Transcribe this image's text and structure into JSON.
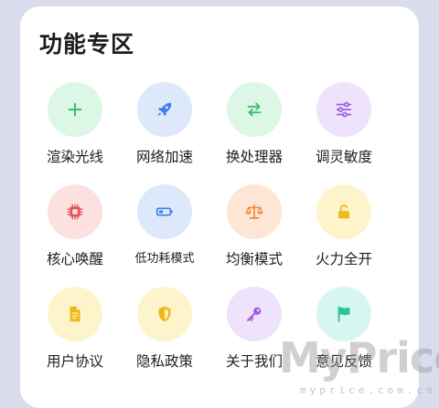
{
  "section": {
    "title": "功能专区"
  },
  "tiles": [
    {
      "label": "渲染光线",
      "icon": "plus-icon",
      "bg": "#dcf7e6",
      "fg": "#3bbf6a"
    },
    {
      "label": "网络加速",
      "icon": "rocket-icon",
      "bg": "#dde9fb",
      "fg": "#3f7ee8"
    },
    {
      "label": "换处理器",
      "icon": "swap-arrows-icon",
      "bg": "#dcf7e6",
      "fg": "#3bbf6a"
    },
    {
      "label": "调灵敏度",
      "icon": "sliders-icon",
      "bg": "#efe3fb",
      "fg": "#a05be0"
    },
    {
      "label": "核心唤醒",
      "icon": "chip-icon",
      "bg": "#fde1e1",
      "fg": "#e65454"
    },
    {
      "label": "低功耗模式",
      "icon": "battery-icon",
      "bg": "#dde9fb",
      "fg": "#3f7ee8"
    },
    {
      "label": "均衡模式",
      "icon": "balance-scale-icon",
      "bg": "#fde6d6",
      "fg": "#ef8a3e"
    },
    {
      "label": "火力全开",
      "icon": "unlock-icon",
      "bg": "#fdf4cc",
      "fg": "#f0b918"
    },
    {
      "label": "用户协议",
      "icon": "document-icon",
      "bg": "#fdf4cc",
      "fg": "#f0b918"
    },
    {
      "label": "隐私政策",
      "icon": "shield-icon",
      "bg": "#fdf4cc",
      "fg": "#f0b918"
    },
    {
      "label": "关于我们",
      "icon": "key-icon",
      "bg": "#efe3fb",
      "fg": "#a05be0"
    },
    {
      "label": "意见反馈",
      "icon": "flag-icon",
      "bg": "#d6f7ef",
      "fg": "#2fbf9c"
    }
  ],
  "watermark": {
    "brand": "MyPrice",
    "url": "myprice.com.cn"
  }
}
